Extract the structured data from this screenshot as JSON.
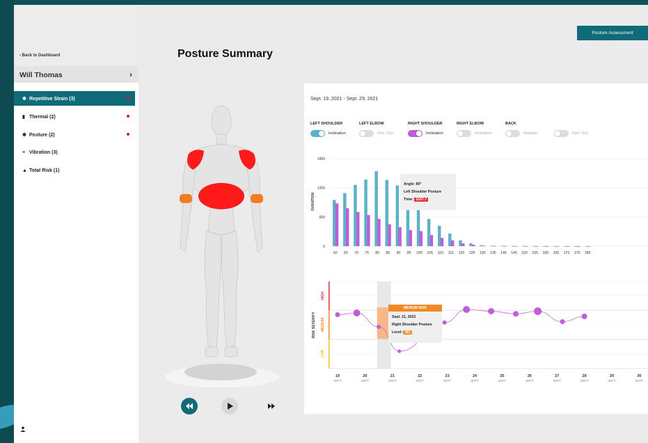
{
  "sidebar": {
    "back_label": "Back to Dashboard",
    "user_name": "Will Thomas",
    "items": [
      {
        "label": "Repetitive Strain (3)",
        "icon": "walking-person-icon",
        "alert": true,
        "active": true
      },
      {
        "label": "Thermal (2)",
        "icon": "thermometer-icon",
        "alert": true,
        "active": false
      },
      {
        "label": "Posture (2)",
        "icon": "posture-icon",
        "alert": true,
        "active": false
      },
      {
        "label": "Vibration (3)",
        "icon": "vibration-icon",
        "alert": false,
        "active": false
      },
      {
        "label": "Total Risk (1)",
        "icon": "warning-icon",
        "alert": false,
        "active": false
      }
    ]
  },
  "header": {
    "title": "Posture Summary",
    "assessment_button": "Posture Assessment"
  },
  "colors": {
    "accent": "#0f6b78",
    "teal_bar": "#5db3c6",
    "purple": "#bf5fd8",
    "alert_red": "#e01b2f",
    "medium_orange": "#f08a24",
    "high_red": "#e0303a",
    "low_yellow": "#f0c020"
  },
  "card": {
    "date_range": "Sept. 19, 2021 - Sept. 29, 2021",
    "toggles": [
      {
        "label": "LEFT SHOULDER",
        "sub": "Inclination",
        "on": true,
        "color": "#5db3c6"
      },
      {
        "label": "LEFT ELBOW",
        "sub": "Flex / Ext",
        "on": false,
        "color": "#dddddd"
      },
      {
        "label": "RIGHT SHOULDER",
        "sub": "Inclination",
        "on": true,
        "color": "#bf5fd8"
      },
      {
        "label": "RIGHT ELBOW",
        "sub": "Inclination",
        "on": false,
        "color": "#dddddd"
      },
      {
        "label": "BACK",
        "sub": "Rotation",
        "on": false,
        "color": "#dddddd"
      },
      {
        "label": "",
        "sub": "Flex / Ext",
        "on": false,
        "color": "#dddddd"
      }
    ],
    "bar_tooltip": {
      "angle": "Angle: 80°",
      "name": "Left Shoulder Posture",
      "time_label": "Time:",
      "time_value": "1537.7"
    },
    "risk_tooltip": {
      "header": "MEDIUM RISK",
      "date": "Sept. 21, 2022",
      "name": "Right Shoulder Posture",
      "level_label": "Level:",
      "level_value": "361"
    }
  },
  "chart_data": [
    {
      "type": "bar",
      "ylabel": "DURATION",
      "ylim": [
        0,
        1800
      ],
      "yticks": [
        "0",
        "600",
        "1200",
        "1800"
      ],
      "categories": [
        "60",
        "65",
        "70",
        "75",
        "80",
        "85",
        "90",
        "95",
        "100",
        "105",
        "110",
        "115",
        "120",
        "125",
        "130",
        "135",
        "140",
        "145",
        "150",
        "155",
        "160",
        "165",
        "170",
        "175",
        "180"
      ],
      "series": [
        {
          "name": "Left Shoulder",
          "color": "#5db3c6",
          "values": [
            950,
            1090,
            1260,
            1370,
            1540,
            1360,
            1250,
            800,
            740,
            560,
            420,
            260,
            120,
            60,
            20,
            10,
            8,
            6,
            5,
            4,
            3,
            3,
            2,
            2,
            2
          ]
        },
        {
          "name": "Right Shoulder",
          "color": "#bf5fd8",
          "values": [
            880,
            780,
            700,
            640,
            560,
            450,
            390,
            330,
            310,
            230,
            170,
            120,
            60,
            30,
            10,
            5,
            4,
            3,
            2,
            2,
            2,
            1,
            1,
            1,
            1
          ]
        }
      ],
      "grid": true
    },
    {
      "type": "line",
      "ylabel": "RISK SEVERITY",
      "bands": [
        "HIGH",
        "MEDIUM",
        "LOW"
      ],
      "x": [
        {
          "d": "19",
          "m": "SEPT"
        },
        {
          "d": "20",
          "m": "SEPT"
        },
        {
          "d": "21",
          "m": "SEPT"
        },
        {
          "d": "22",
          "m": "SEPT"
        },
        {
          "d": "23",
          "m": "SEPT"
        },
        {
          "d": "24",
          "m": "SEPT"
        },
        {
          "d": "25",
          "m": "SEPT"
        },
        {
          "d": "26",
          "m": "SEPT"
        },
        {
          "d": "27",
          "m": "SEPT"
        },
        {
          "d": "28",
          "m": "SEPT"
        },
        {
          "d": "29",
          "m": "SEPT"
        },
        {
          "d": "30",
          "m": "SEPT"
        }
      ],
      "points": [
        {
          "x": 19.0,
          "y": 0.62
        },
        {
          "x": 19.7,
          "y": 0.64
        },
        {
          "x": 20.5,
          "y": 0.48
        },
        {
          "x": 21.25,
          "y": 0.2
        },
        {
          "x": 22.9,
          "y": 0.53
        },
        {
          "x": 23.7,
          "y": 0.68
        },
        {
          "x": 24.6,
          "y": 0.66
        },
        {
          "x": 25.5,
          "y": 0.63
        },
        {
          "x": 26.3,
          "y": 0.66
        },
        {
          "x": 27.2,
          "y": 0.54
        },
        {
          "x": 28.0,
          "y": 0.6
        }
      ],
      "highlight_x": 21.0
    }
  ],
  "playback": {
    "rewind": "rewind-icon",
    "play": "play-icon",
    "forward": "fast-forward-icon"
  }
}
